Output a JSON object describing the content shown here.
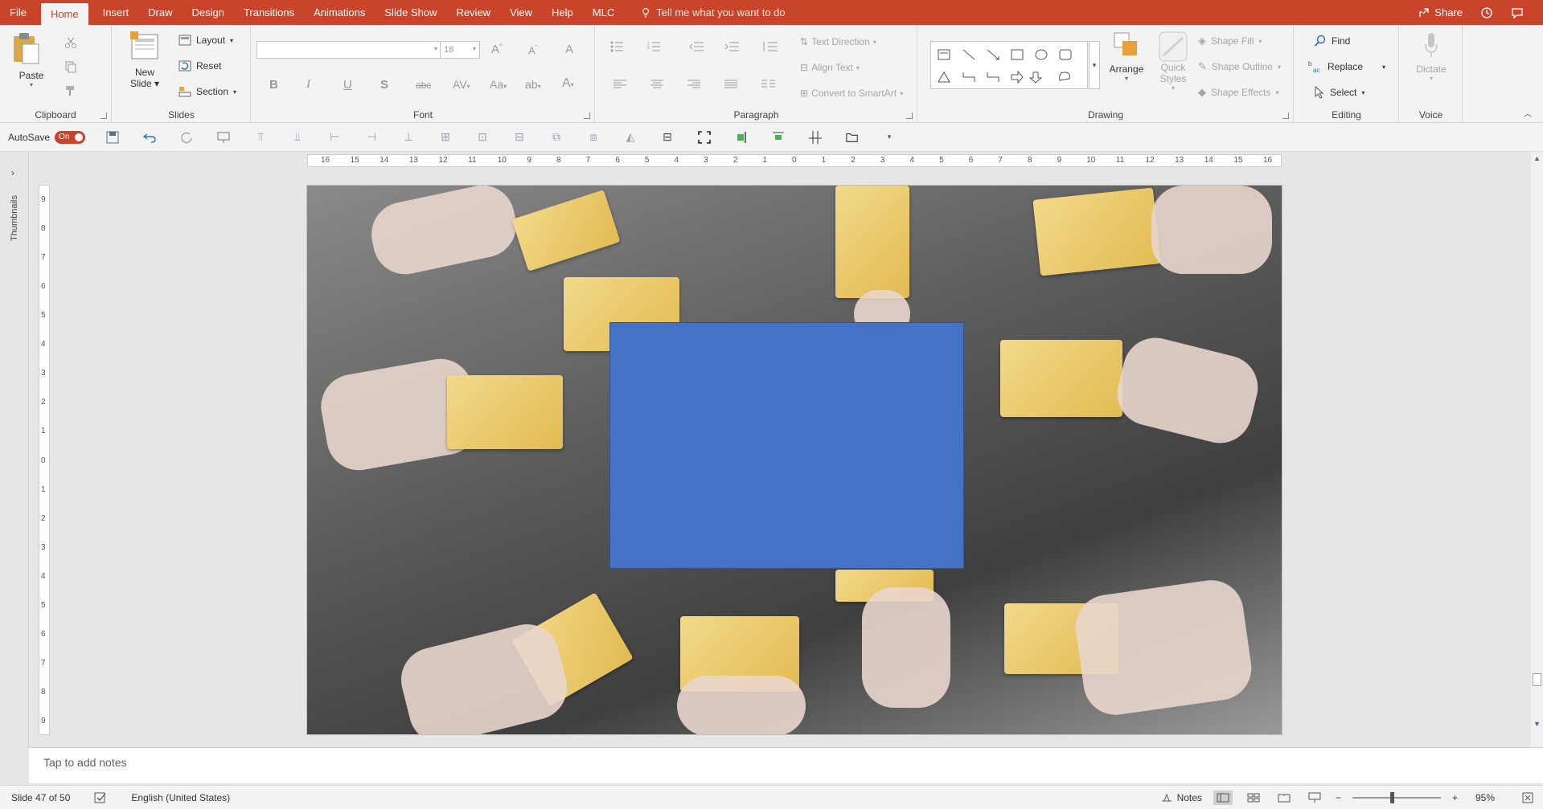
{
  "tabs": [
    "File",
    "Home",
    "Insert",
    "Draw",
    "Design",
    "Transitions",
    "Animations",
    "Slide Show",
    "Review",
    "View",
    "Help",
    "MLC"
  ],
  "active_tab": "Home",
  "tellme": "Tell me what you want to do",
  "share": "Share",
  "ribbon": {
    "clipboard": {
      "label": "Clipboard",
      "paste": "Paste"
    },
    "slides": {
      "label": "Slides",
      "new_slide_1": "New",
      "new_slide_2": "Slide",
      "layout": "Layout",
      "reset": "Reset",
      "section": "Section"
    },
    "font": {
      "label": "Font",
      "font_name": "",
      "font_size": "18"
    },
    "paragraph": {
      "label": "Paragraph",
      "text_direction": "Text Direction",
      "align_text": "Align Text",
      "convert_smartart": "Convert to SmartArt"
    },
    "drawing": {
      "label": "Drawing",
      "arrange": "Arrange",
      "quick_styles_1": "Quick",
      "quick_styles_2": "Styles",
      "shape_fill": "Shape Fill",
      "shape_outline": "Shape Outline",
      "shape_effects": "Shape Effects"
    },
    "editing": {
      "label": "Editing",
      "find": "Find",
      "replace": "Replace",
      "select": "Select"
    },
    "voice": {
      "label": "Voice",
      "dictate": "Dictate"
    }
  },
  "qat": {
    "autosave": "AutoSave",
    "autosave_state": "On"
  },
  "left_pane": {
    "thumbnails": "Thumbnails"
  },
  "hruler_labels": [
    "16",
    "15",
    "14",
    "13",
    "12",
    "11",
    "10",
    "9",
    "8",
    "7",
    "6",
    "5",
    "4",
    "3",
    "2",
    "1",
    "0",
    "1",
    "2",
    "3",
    "4",
    "5",
    "6",
    "7",
    "8",
    "9",
    "10",
    "11",
    "12",
    "13",
    "14",
    "15",
    "16"
  ],
  "vruler_labels": [
    "9",
    "8",
    "7",
    "6",
    "5",
    "4",
    "3",
    "2",
    "1",
    "0",
    "1",
    "2",
    "3",
    "4",
    "5",
    "6",
    "7",
    "8",
    "9"
  ],
  "notes_placeholder": "Tap to add notes",
  "status": {
    "slide_info": "Slide 47 of 50",
    "language": "English (United States)",
    "notes": "Notes",
    "zoom": "95%",
    "zoom_level": 0.45
  },
  "colors": {
    "accent": "#c8452b",
    "shape_fill": "#4472c4"
  }
}
